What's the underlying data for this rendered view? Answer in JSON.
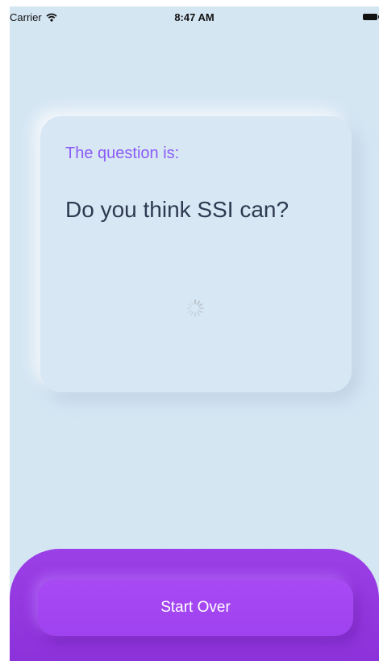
{
  "status_bar": {
    "carrier": "Carrier",
    "time": "8:47 AM",
    "wifi_icon": "wifi-icon",
    "battery_icon": "battery-icon"
  },
  "card": {
    "label": "The question is:",
    "question": "Do you think SSI can?",
    "spinner_icon": "loading-spinner-icon"
  },
  "bottom": {
    "button_label": "Start Over"
  },
  "colors": {
    "background": "#d5e6f3",
    "label": "#8b5cf6",
    "question_text": "#2f3a52",
    "accent": "#9b3fe6"
  }
}
